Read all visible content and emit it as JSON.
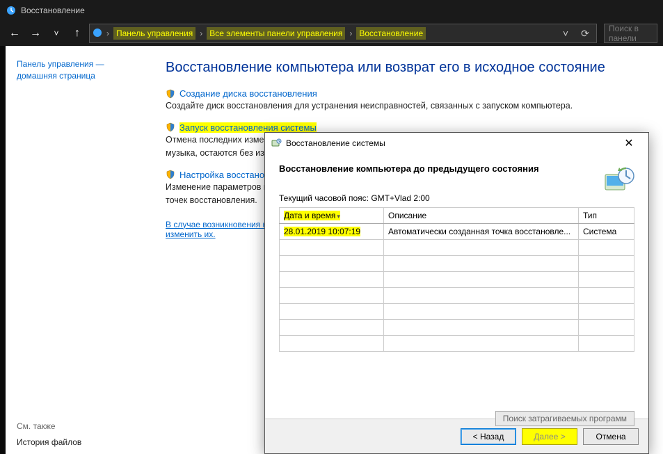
{
  "window": {
    "title": "Восстановление"
  },
  "breadcrumbs": {
    "b1": "Панель управления",
    "b2": "Все элементы панели управления",
    "b3": "Восстановление"
  },
  "search": {
    "placeholder": "Поиск в панели"
  },
  "sidebar": {
    "home": "Панель управления — домашняя страница",
    "see_also_label": "См. также",
    "history": "История файлов"
  },
  "main": {
    "heading": "Восстановление компьютера или возврат его в исходное состояние",
    "link1": "Создание диска восстановления",
    "desc1": "Создайте диск восстановления для устранения неисправностей, связанных с запуском компьютера.",
    "link2": "Запуск восстановления системы",
    "desc2a": "Отмена последних измен",
    "desc2b": "музыка, остаются без изме",
    "link3": "Настройка восстановления",
    "desc3a": "Изменение параметров во",
    "desc3b": "точек восстановления.",
    "opt_a": "В случае возникновения н",
    "opt_b": "изменить их."
  },
  "dialog": {
    "title": "Восстановление системы",
    "heading": "Восстановление компьютера до предыдущего состояния",
    "tz_label": "Текущий часовой пояс: GMT+Vlad 2:00",
    "columns": {
      "date": "Дата и время",
      "desc": "Описание",
      "type": "Тип"
    },
    "row": {
      "date": "28.01.2019 10:07:19",
      "desc": "Автоматически созданная точка восстановле...",
      "type": "Система"
    },
    "affected": "Поиск затрагиваемых программ",
    "back": "< Назад",
    "next": "Далее >",
    "cancel": "Отмена"
  }
}
